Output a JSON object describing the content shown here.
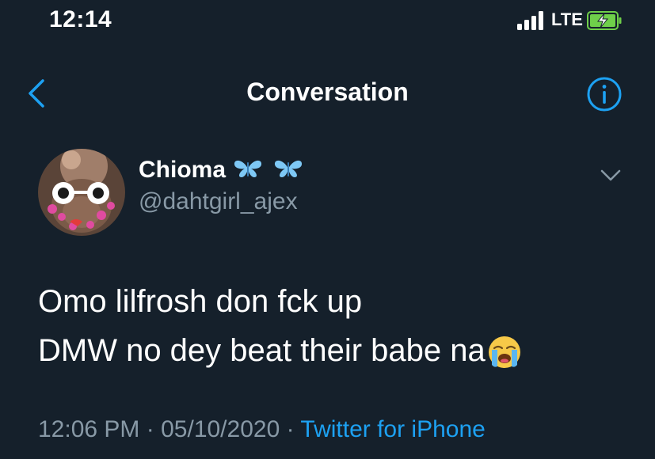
{
  "status_bar": {
    "time": "12:14",
    "network": "LTE",
    "icons": [
      "signal-icon",
      "battery-charging-icon"
    ]
  },
  "nav": {
    "title": "Conversation",
    "icons": [
      "back-chevron-icon",
      "info-icon"
    ]
  },
  "tweet": {
    "display_name": "Chioma",
    "name_icons": [
      "butterfly-icon",
      "butterfly-icon"
    ],
    "handle": "@dahtgirl_ajex",
    "text_lines": [
      "Omo lilfrosh don fck up",
      "DMW no dey beat their babe na"
    ],
    "text_emoji": "loudly-crying-face-icon",
    "time": "12:06 PM",
    "separator": "·",
    "date": "05/10/2020",
    "source": "Twitter for iPhone",
    "menu_icon": "chevron-down-icon"
  },
  "colors": {
    "background": "#15202b",
    "text_primary": "#ffffff",
    "text_secondary": "#8899a6",
    "accent": "#1da1f2",
    "butterfly": "#7ec8f5"
  }
}
